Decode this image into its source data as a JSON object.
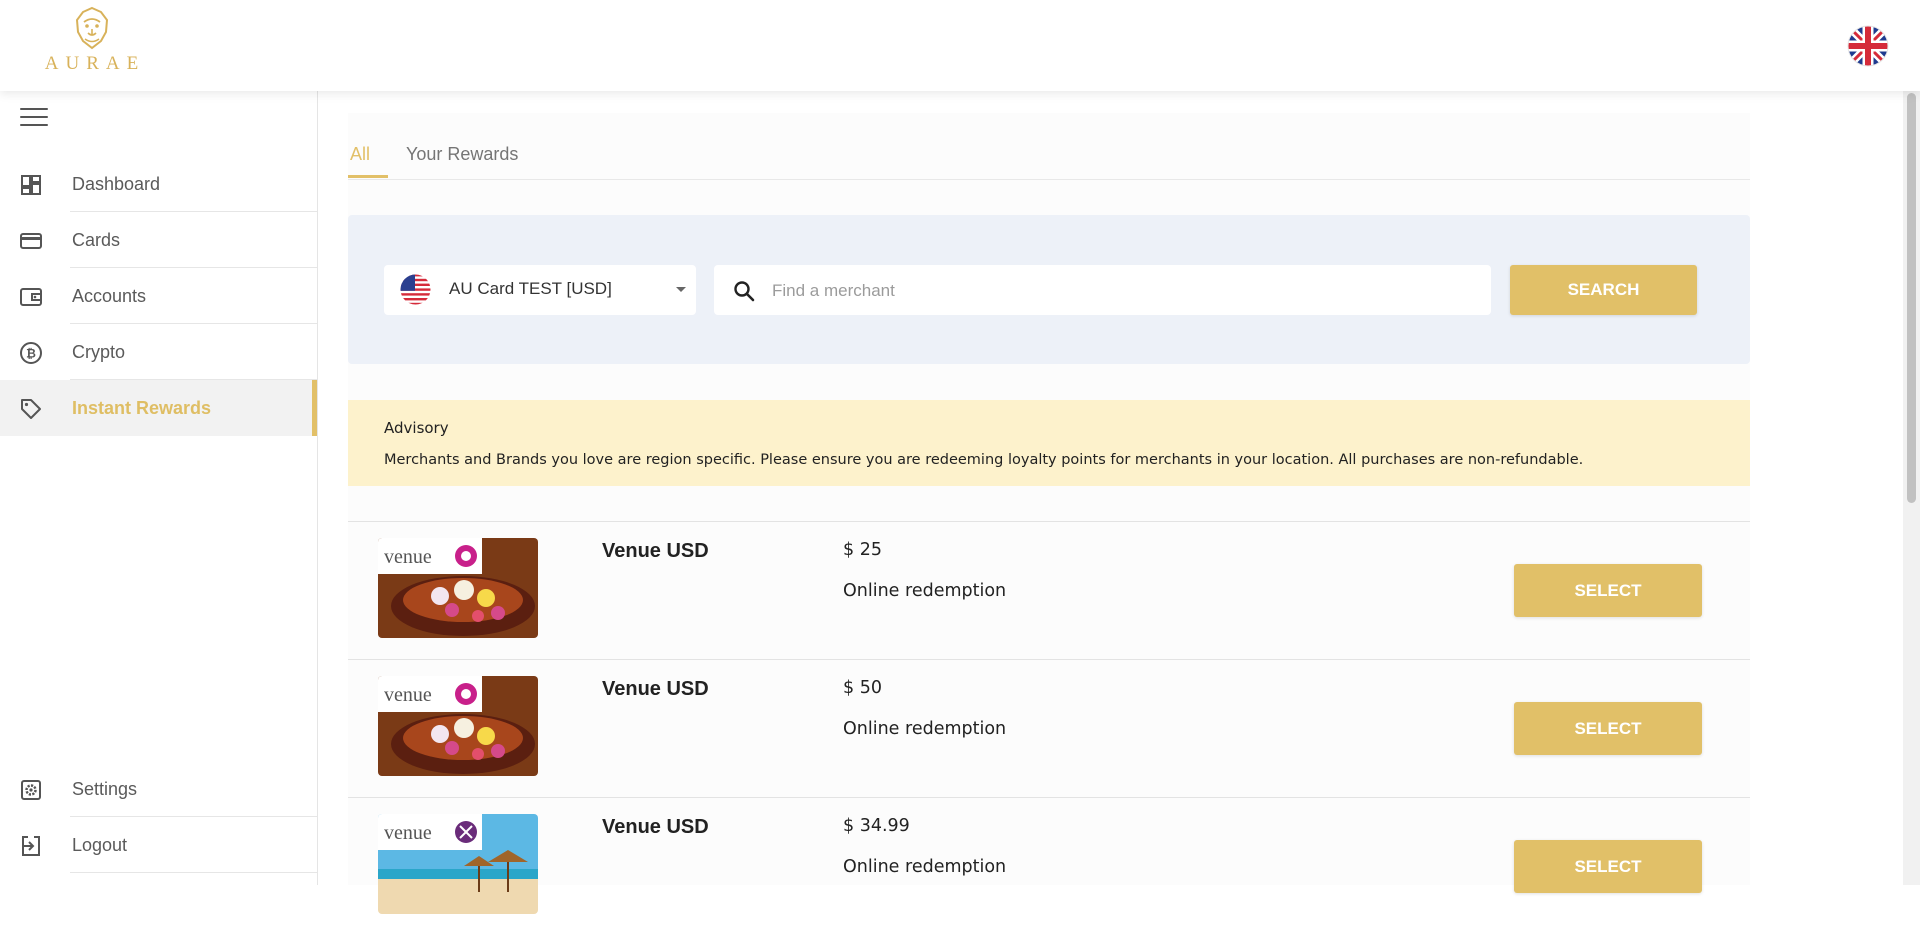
{
  "brand": {
    "name": "AURAE"
  },
  "header": {
    "language_flag": "uk-flag-icon"
  },
  "sidebar": {
    "items": [
      {
        "label": "Dashboard",
        "icon": "dashboard-icon"
      },
      {
        "label": "Cards",
        "icon": "credit-card-icon"
      },
      {
        "label": "Accounts",
        "icon": "wallet-icon"
      },
      {
        "label": "Crypto",
        "icon": "bitcoin-icon"
      },
      {
        "label": "Instant Rewards",
        "icon": "tag-icon",
        "active": true
      }
    ],
    "bottom_items": [
      {
        "label": "Settings",
        "icon": "settings-icon"
      },
      {
        "label": "Logout",
        "icon": "logout-icon"
      }
    ]
  },
  "tabs": [
    {
      "label": "All",
      "active": true
    },
    {
      "label": "Your Rewards",
      "active": false
    }
  ],
  "search": {
    "card_selected": "AU Card TEST [USD]",
    "placeholder": "Find a merchant",
    "button_label": "SEARCH"
  },
  "advisory": {
    "title": "Advisory",
    "message": "Merchants and Brands you love are region specific. Please ensure you are redeeming loyalty points for merchants in your location. All purchases are non-refundable."
  },
  "rewards": [
    {
      "name": "Venue USD",
      "price": "$ 25",
      "redemption": "Online redemption",
      "button": "SELECT",
      "image": "venue-spa"
    },
    {
      "name": "Venue USD",
      "price": "$ 50",
      "redemption": "Online redemption",
      "button": "SELECT",
      "image": "venue-spa"
    },
    {
      "name": "Venue USD",
      "price": "$ 34.99",
      "redemption": "Online redemption",
      "button": "SELECT",
      "image": "venue-resorts"
    }
  ],
  "colors": {
    "accent": "#e1c068",
    "advisory_bg": "#fdf2cc",
    "search_panel_bg": "#edf1f8"
  }
}
